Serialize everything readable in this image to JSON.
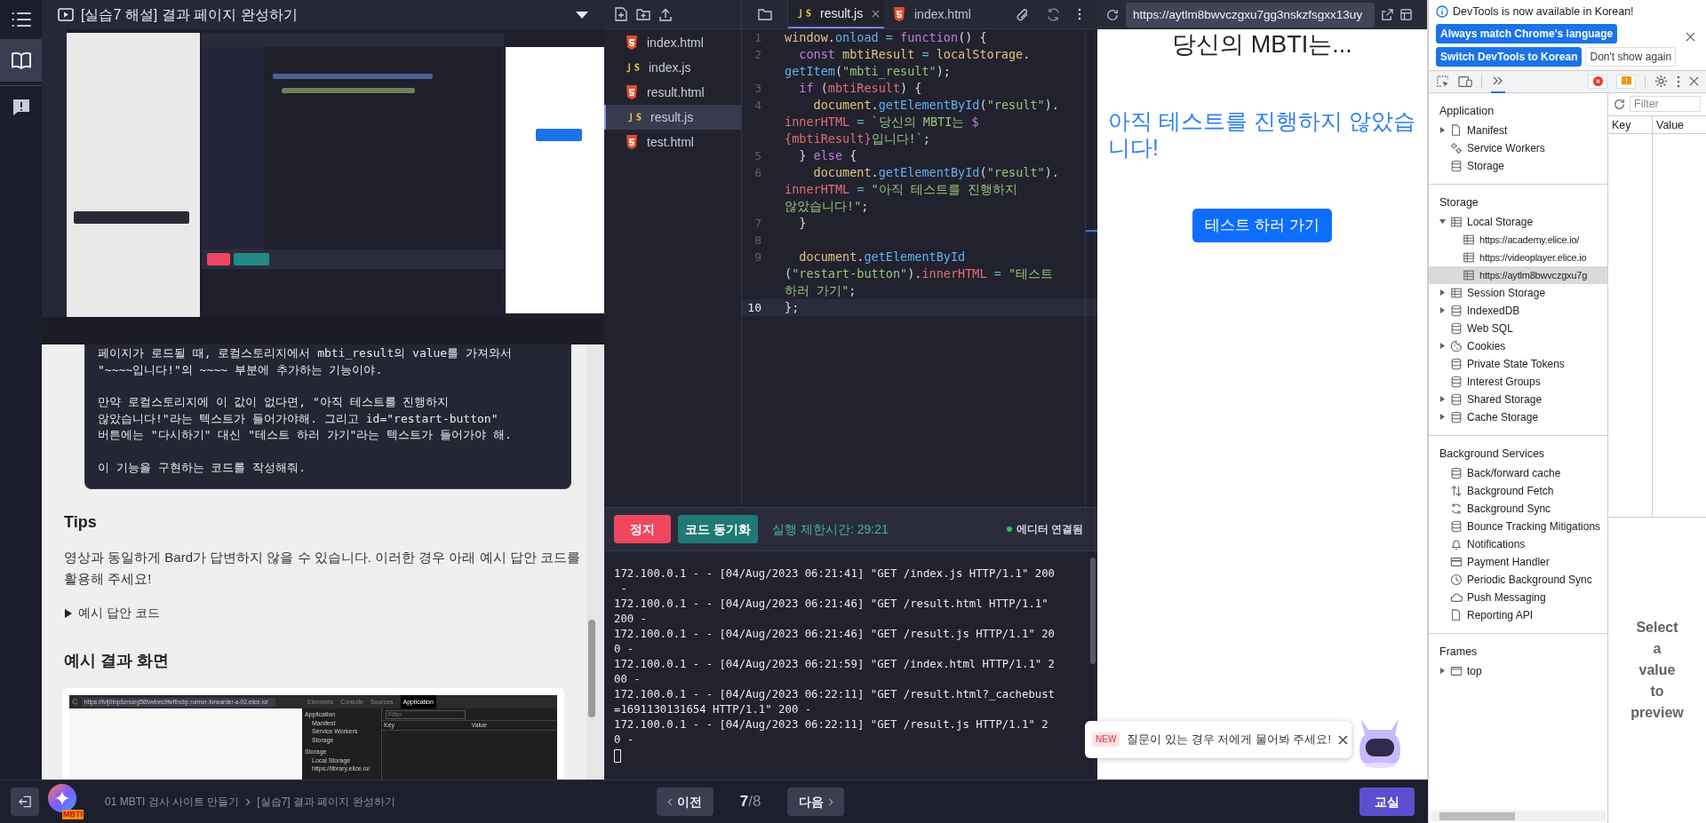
{
  "rail": {
    "items": [
      {
        "selected": false
      },
      {
        "selected": true
      },
      {
        "selected": false
      }
    ]
  },
  "lesson": {
    "title": "[실습7 해설] 결과 페이지 완성하기",
    "video": {
      "kind": "picture"
    },
    "prompt_paragraphs": [
      "페이지가 로드될 때, 로컬스토리지에서 mbti_result의 value를 가져와서\n\"~~~~입니다!\"의 ~~~~ 부분에 추가하는 기능이야.",
      "만약 로컬스토리지에 이 값이 없다면, \"아직 테스트를 진행하지\n않았습니다!\"라는 텍스트가 들어가야해. 그리고 id=\"restart-button\"\n버튼에는 \"다시하기\" 대신 \"테스트 하러 가기\"라는 텍스트가 들어가야 해.",
      "이 기능을 구현하는 코드를 작성해줘."
    ],
    "tips": {
      "heading": "Tips",
      "text": "영상과 동일하게 Bard가 답변하지 않을 수 있습니다. 이러한 경우 아래 예시 답안 코드를 활용해 주세요!"
    },
    "details": {
      "summary": "예시 답안 코드",
      "expanded": false
    },
    "result": {
      "heading": "예시 결과 화면",
      "image": {
        "url": "https://tvfj0tnp6zrsorg56fwvbes9fwfthcbp.runner-forwarder-a-02.elice.io/",
        "tabs": [
          {
            "label": "Elements",
            "selected": false
          },
          {
            "label": "Console",
            "selected": false
          },
          {
            "label": "Sources",
            "selected": false
          },
          {
            "label": "Application",
            "selected": true
          }
        ],
        "sidebar": [
          "Application",
          "Manifest",
          "Service Workers",
          "Storage",
          "Storage",
          "Local Storage",
          "https://library.elice.io/"
        ],
        "filter_placeholder": "Filter",
        "columns": [
          "Key",
          "Value"
        ]
      }
    }
  },
  "editor": {
    "file_tree": [
      {
        "name": "index.html",
        "kind": "html",
        "selected": false
      },
      {
        "name": "index.js",
        "kind": "js",
        "selected": false
      },
      {
        "name": "result.html",
        "kind": "html",
        "selected": false
      },
      {
        "name": "result.js",
        "kind": "js",
        "selected": true
      },
      {
        "name": "test.html",
        "kind": "html",
        "selected": false
      }
    ],
    "tabs": [
      {
        "label": "result.js",
        "kind": "js",
        "selected": true
      },
      {
        "label": "index.html",
        "kind": "html",
        "selected": false
      }
    ],
    "code_lines": [
      {
        "number": "1",
        "current": false,
        "rows": [
          {
            "tokens": [
              {
                "kind": "ident",
                "text": "window"
              },
              {
                "kind": "plain",
                "text": "."
              },
              {
                "kind": "prop",
                "text": "onload"
              },
              {
                "kind": "op",
                "text": " = "
              },
              {
                "kind": "kw",
                "text": "function"
              },
              {
                "kind": "plain",
                "text": "() {"
              }
            ]
          }
        ]
      },
      {
        "number": "2",
        "current": false,
        "rows": [
          {
            "tokens": [
              {
                "kind": "kw",
                "text": "  const"
              },
              {
                "kind": "ident",
                "text": " mbtiResult"
              },
              {
                "kind": "op",
                "text": " = "
              },
              {
                "kind": "ident",
                "text": "localStorage"
              },
              {
                "kind": "plain",
                "text": "."
              }
            ]
          },
          {
            "tokens": [
              {
                "kind": "prop",
                "text": "getItem"
              },
              {
                "kind": "plain",
                "text": "("
              },
              {
                "kind": "str",
                "text": "\"mbti_result\""
              },
              {
                "kind": "plain",
                "text": ");"
              }
            ]
          }
        ]
      },
      {
        "number": "3",
        "current": false,
        "rows": [
          {
            "tokens": [
              {
                "kind": "kw",
                "text": "  if"
              },
              {
                "kind": "plain",
                "text": " ("
              },
              {
                "kind": "ref",
                "text": "mbtiResult"
              },
              {
                "kind": "plain",
                "text": ") {"
              }
            ]
          }
        ]
      },
      {
        "number": "4",
        "current": false,
        "rows": [
          {
            "tokens": [
              {
                "kind": "ident",
                "text": "    document"
              },
              {
                "kind": "plain",
                "text": "."
              },
              {
                "kind": "prop",
                "text": "getElementById"
              },
              {
                "kind": "plain",
                "text": "("
              },
              {
                "kind": "str",
                "text": "\"result\""
              },
              {
                "kind": "plain",
                "text": ")."
              }
            ]
          },
          {
            "tokens": [
              {
                "kind": "ref",
                "text": "innerHTML"
              },
              {
                "kind": "op",
                "text": " = "
              },
              {
                "kind": "str",
                "text": "`당신의 MBTI는 "
              },
              {
                "kind": "kw",
                "text": "$"
              }
            ]
          },
          {
            "tokens": [
              {
                "kind": "ref",
                "text": "{mbtiResult}"
              },
              {
                "kind": "str",
                "text": "입니다!`"
              },
              {
                "kind": "plain",
                "text": ";"
              }
            ]
          }
        ]
      },
      {
        "number": "5",
        "current": false,
        "rows": [
          {
            "tokens": [
              {
                "kind": "plain",
                "text": "  } "
              },
              {
                "kind": "kw",
                "text": "else"
              },
              {
                "kind": "plain",
                "text": " {"
              }
            ]
          }
        ]
      },
      {
        "number": "6",
        "current": false,
        "rows": [
          {
            "tokens": [
              {
                "kind": "ident",
                "text": "    document"
              },
              {
                "kind": "plain",
                "text": "."
              },
              {
                "kind": "prop",
                "text": "getElementById"
              },
              {
                "kind": "plain",
                "text": "("
              },
              {
                "kind": "str",
                "text": "\"result\""
              },
              {
                "kind": "plain",
                "text": ")."
              }
            ]
          },
          {
            "tokens": [
              {
                "kind": "ref",
                "text": "innerHTML"
              },
              {
                "kind": "op",
                "text": " = "
              },
              {
                "kind": "str",
                "text": "\"아직 테스트를 진행하지"
              }
            ]
          },
          {
            "tokens": [
              {
                "kind": "str",
                "text": "않았습니다!\""
              },
              {
                "kind": "plain",
                "text": ";"
              }
            ]
          }
        ]
      },
      {
        "number": "7",
        "current": false,
        "rows": [
          {
            "tokens": [
              {
                "kind": "plain",
                "text": "  }"
              }
            ]
          }
        ]
      },
      {
        "number": "8",
        "current": false
      },
      {
        "number": "9",
        "current": false,
        "rows": [
          {
            "tokens": [
              {
                "kind": "ident",
                "text": "  document"
              },
              {
                "kind": "plain",
                "text": "."
              },
              {
                "kind": "prop",
                "text": "getElementById"
              }
            ]
          },
          {
            "tokens": [
              {
                "kind": "plain",
                "text": "("
              },
              {
                "kind": "str",
                "text": "\"restart-button\""
              },
              {
                "kind": "plain",
                "text": ")."
              },
              {
                "kind": "ref",
                "text": "innerHTML"
              },
              {
                "kind": "op",
                "text": " = "
              },
              {
                "kind": "str",
                "text": "\"테스트"
              }
            ]
          },
          {
            "tokens": [
              {
                "kind": "str",
                "text": "하러 가기\""
              },
              {
                "kind": "plain",
                "text": ";"
              }
            ]
          }
        ]
      },
      {
        "number": "10",
        "current": true,
        "rows": [
          {
            "tokens": [
              {
                "kind": "plain",
                "text": "};"
              }
            ]
          }
        ]
      }
    ],
    "run_bar": {
      "stop": "정지",
      "sync": "코드 동기화",
      "time_limit": "실행 제한시간: 29:21",
      "status": "에디터 연결됨",
      "connected": true
    },
    "terminal": {
      "lines": [
        "172.100.0.1 - - [04/Aug/2023 06:21:41] \"GET /index.js HTTP/1.1\" 200",
        " -",
        "172.100.0.1 - - [04/Aug/2023 06:21:46] \"GET /result.html HTTP/1.1\"",
        "200 -",
        "172.100.0.1 - - [04/Aug/2023 06:21:46] \"GET /result.js HTTP/1.1\" 20",
        "0 -",
        "172.100.0.1 - - [04/Aug/2023 06:21:59] \"GET /index.html HTTP/1.1\" 2",
        "00 -",
        "172.100.0.1 - - [04/Aug/2023 06:22:11] \"GET /result.html?_cachebust",
        "=1691130131654 HTTP/1.1\" 200 -",
        "172.100.0.1 - - [04/Aug/2023 06:22:11] \"GET /result.js HTTP/1.1\" 2",
        "0 -"
      ]
    }
  },
  "preview": {
    "url": "https://aytlm8bwvczgxu7gg3nskzfsgxx13uy",
    "heading": "당신의 MBTI는...",
    "message": "아직 테스트를 진행하지 않았습니다!",
    "button": "테스트 하러 가기"
  },
  "devtools": {
    "infobar": {
      "text": "DevTools is now available in Korean!",
      "buttons": [
        {
          "label": "Always match Chrome's language",
          "kind": "primary"
        },
        {
          "label": "Switch DevTools to Korean",
          "kind": "primary"
        },
        {
          "label": "Don't show again",
          "kind": "secondary"
        }
      ]
    },
    "sections": [
      {
        "heading": "Application",
        "items": [
          {
            "label": "Manifest",
            "expanded": false,
            "selected": false
          },
          {
            "label": "Service Workers",
            "selected": false
          },
          {
            "label": "Storage",
            "selected": false
          }
        ]
      },
      {
        "heading": "Storage",
        "items": [
          {
            "label": "Local Storage",
            "expanded": true,
            "selected": false,
            "children": [
              {
                "label": "https://academy.elice.io/",
                "selected": false
              },
              {
                "label": "https://videoplayer.elice.io",
                "selected": false
              },
              {
                "label": "https://aytlm8bwvczgxu7g",
                "selected": true
              }
            ]
          },
          {
            "label": "Session Storage",
            "expanded": false,
            "selected": false
          },
          {
            "label": "IndexedDB",
            "expanded": false,
            "selected": false
          },
          {
            "label": "Web SQL",
            "selected": false
          },
          {
            "label": "Cookies",
            "expanded": false,
            "selected": false
          },
          {
            "label": "Private State Tokens",
            "selected": false
          },
          {
            "label": "Interest Groups",
            "selected": false
          },
          {
            "label": "Shared Storage",
            "expanded": false,
            "selected": false
          },
          {
            "label": "Cache Storage",
            "expanded": false,
            "selected": false
          }
        ]
      },
      {
        "heading": "Background Services",
        "items": [
          {
            "label": "Back/forward cache",
            "selected": false
          },
          {
            "label": "Background Fetch",
            "selected": false
          },
          {
            "label": "Background Sync",
            "selected": false
          },
          {
            "label": "Bounce Tracking Mitigations",
            "selected": false
          },
          {
            "label": "Notifications",
            "selected": false
          },
          {
            "label": "Payment Handler",
            "selected": false
          },
          {
            "label": "Periodic Background Sync",
            "selected": false
          },
          {
            "label": "Push Messaging",
            "selected": false
          },
          {
            "label": "Reporting API",
            "selected": false
          }
        ]
      },
      {
        "heading": "Frames",
        "items": [
          {
            "label": "top",
            "expanded": false,
            "selected": false
          }
        ]
      }
    ],
    "filter_placeholder": "Filter",
    "columns": [
      "Key",
      "Value"
    ],
    "preview_hint": "Select a value to preview"
  },
  "assistant_popup": {
    "badge": "NEW",
    "text": "질문이 있는 경우 저에게 물어봐 주세요!"
  },
  "bottom_bar": {
    "logo_badge": "MBTI",
    "breadcrumb": [
      "01 MBTI 검사 사이트 만들기",
      "[실습7] 결과 페이지 완성하기"
    ],
    "prev": "이전",
    "page_current": "7",
    "page_total": "/8",
    "next": "다음",
    "classroom": "교실"
  }
}
